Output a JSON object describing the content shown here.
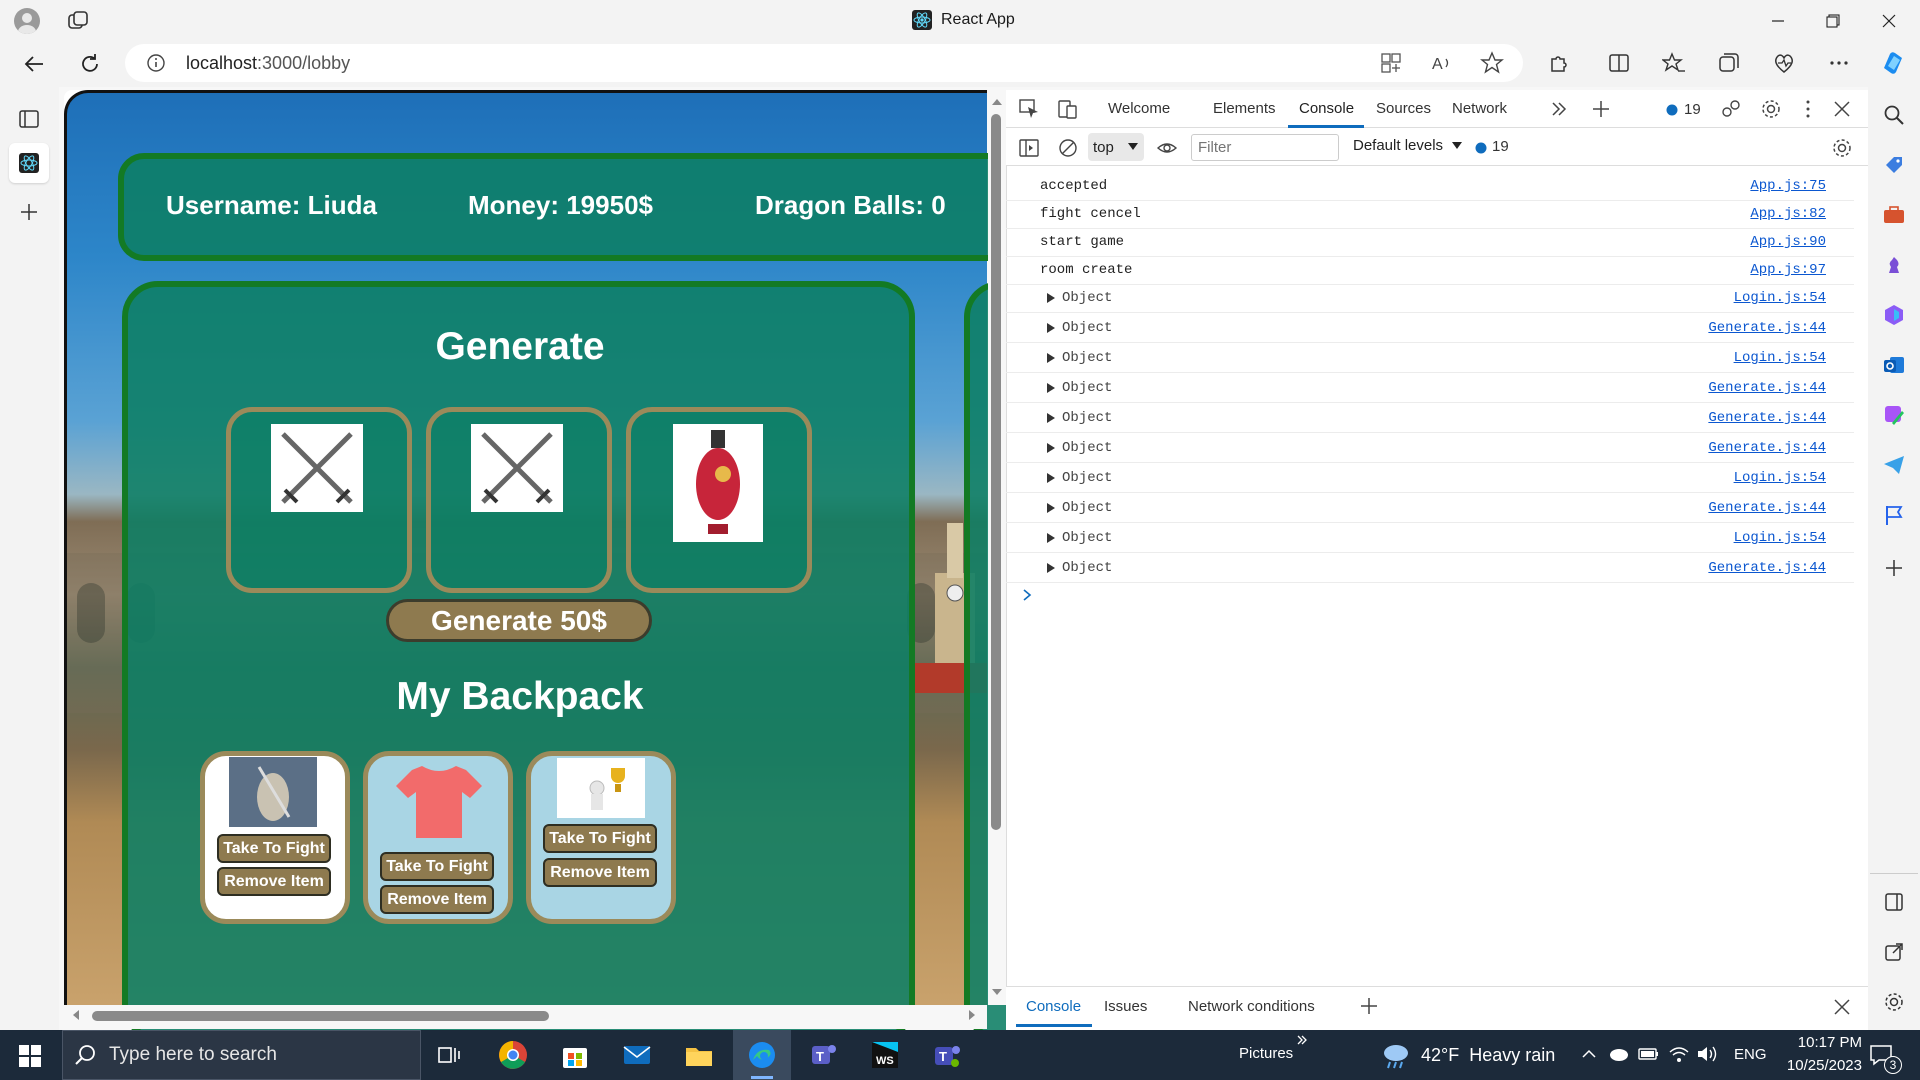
{
  "window": {
    "title": "React App"
  },
  "browser": {
    "url_host": "localhost",
    "url_path": ":3000/lobby"
  },
  "page": {
    "header": {
      "username": "Username: Liuda",
      "money": "Money: 19950$",
      "dragon_balls": "Dragon Balls: 0"
    },
    "generate": {
      "title": "Generate",
      "slots": [
        {
          "icon": "crossed-swords-icon"
        },
        {
          "icon": "crossed-swords-icon"
        },
        {
          "icon": "potion-bottle-icon"
        }
      ],
      "button_label": "Generate 50$"
    },
    "backpack": {
      "title": "My Backpack",
      "items": [
        {
          "icon": "warrior-image",
          "take_label": "Take To Fight",
          "remove_label": "Remove Item",
          "bg": "#ffffff"
        },
        {
          "icon": "red-shirt-icon",
          "take_label": "Take To Fight",
          "remove_label": "Remove Item",
          "bg": "#a9d5e4"
        },
        {
          "icon": "trophy-figure-icon",
          "take_label": "Take To Fight",
          "remove_label": "Remove Item",
          "bg": "#a9d5e4"
        }
      ]
    }
  },
  "devtools": {
    "tabs": [
      "Welcome",
      "Elements",
      "Console",
      "Sources",
      "Network"
    ],
    "active_tab": "Console",
    "issues_count": "19",
    "context": "top",
    "filter_placeholder": "Filter",
    "levels": "Default levels",
    "messages_count": "19",
    "console_rows": [
      {
        "msg": "accepted",
        "src": "App.js:75",
        "expandable": false
      },
      {
        "msg": "fight cencel",
        "src": "App.js:82",
        "expandable": false
      },
      {
        "msg": "start game",
        "src": "App.js:90",
        "expandable": false
      },
      {
        "msg": "room create",
        "src": "App.js:97",
        "expandable": false
      },
      {
        "msg": "Object",
        "src": "Login.js:54",
        "expandable": true
      },
      {
        "msg": "Object",
        "src": "Generate.js:44",
        "expandable": true
      },
      {
        "msg": "Object",
        "src": "Login.js:54",
        "expandable": true
      },
      {
        "msg": "Object",
        "src": "Generate.js:44",
        "expandable": true
      },
      {
        "msg": "Object",
        "src": "Generate.js:44",
        "expandable": true
      },
      {
        "msg": "Object",
        "src": "Generate.js:44",
        "expandable": true
      },
      {
        "msg": "Object",
        "src": "Login.js:54",
        "expandable": true
      },
      {
        "msg": "Object",
        "src": "Generate.js:44",
        "expandable": true
      },
      {
        "msg": "Object",
        "src": "Login.js:54",
        "expandable": true
      },
      {
        "msg": "Object",
        "src": "Generate.js:44",
        "expandable": true
      }
    ],
    "drawer_tabs": [
      "Console",
      "Issues",
      "Network conditions"
    ]
  },
  "taskbar": {
    "search_placeholder": "Type here to search",
    "pictures_label": "Pictures",
    "weather": "42°F  Heavy rain",
    "language": "ENG",
    "time": "10:17 PM",
    "date": "10/25/2023",
    "notifications": "3"
  },
  "colors": {
    "panel_green": "#0c7e64",
    "panel_border": "#137a24",
    "button_brown": "#8e7a4f",
    "slot_border": "#9b8a5a",
    "devtools_accent": "#0f6cbd",
    "link_blue": "#0b57d0"
  }
}
